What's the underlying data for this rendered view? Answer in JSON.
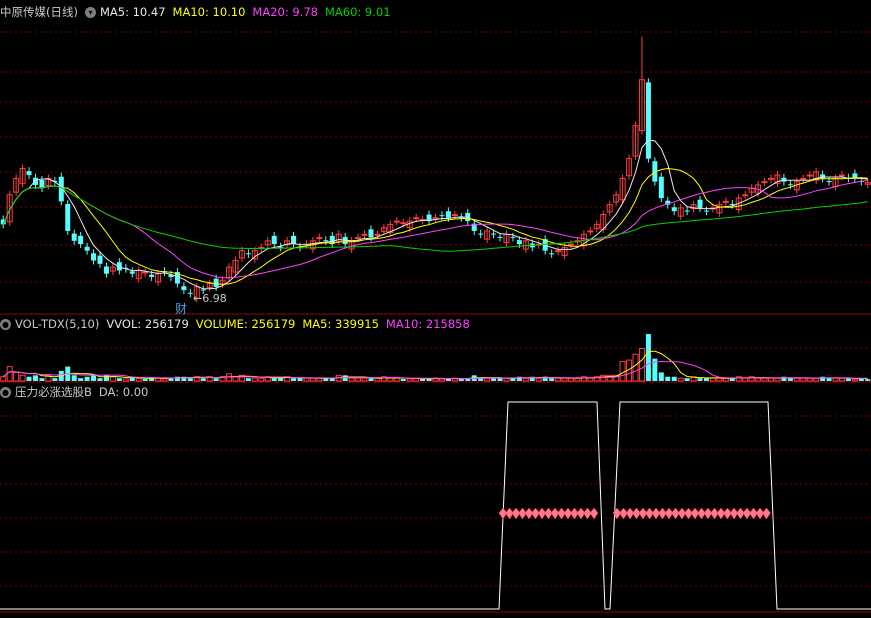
{
  "main_header": {
    "stock_title": "中原传媒(日线)",
    "ma5": "MA5: 10.47",
    "ma10": "MA10: 10.10",
    "ma20": "MA20: 9.78",
    "ma60": "MA60: 9.01"
  },
  "vol_header": {
    "indicator": "VOL-TDX(5,10)",
    "vvol": "VVOL: 256179",
    "volume": "VOLUME: 256179",
    "ma5": "MA5: 339915",
    "ma10": "MA10: 215858"
  },
  "custom_header": {
    "indicator": "压力必涨选股B",
    "da": "DA: 0.00"
  },
  "annotations": {
    "low_price": "6.98",
    "financial_marker": "财"
  },
  "colors": {
    "up": "#ff3c3c",
    "down": "#54ffff",
    "ma5": "#e8e8e8",
    "ma10": "#ffff00",
    "ma20": "#ff40ff",
    "ma60": "#00d200",
    "grid": "#7a0000",
    "signal_marker": "#ff7a8a"
  },
  "chart_data": {
    "type": "candlestick",
    "closes": [
      9.2,
      10.1,
      10.6,
      10.9,
      10.7,
      10.4,
      10.3,
      10.6,
      10.5,
      9.9,
      9.0,
      8.7,
      8.6,
      8.4,
      8.1,
      8.0,
      7.7,
      7.9,
      7.8,
      7.85,
      7.7,
      7.8,
      7.75,
      7.6,
      7.7,
      7.75,
      7.6,
      7.4,
      7.2,
      7.1,
      7.3,
      7.2,
      7.4,
      7.3,
      7.5,
      7.9,
      8.1,
      8.4,
      8.3,
      8.4,
      8.5,
      8.7,
      8.6,
      8.5,
      8.7,
      8.6,
      8.5,
      8.6,
      8.7,
      8.8,
      8.7,
      8.6,
      8.9,
      8.6,
      8.7,
      8.8,
      8.9,
      8.8,
      8.9,
      9.1,
      9.2,
      9.3,
      9.25,
      9.3,
      9.4,
      9.35,
      9.3,
      9.4,
      9.45,
      9.4,
      9.5,
      9.4,
      9.3,
      9.0,
      8.9,
      9.0,
      8.9,
      8.8,
      8.9,
      8.8,
      8.6,
      8.7,
      8.5,
      8.6,
      8.4,
      8.3,
      8.4,
      8.5,
      8.6,
      8.7,
      8.9,
      9.0,
      9.2,
      9.5,
      9.8,
      10.1,
      10.6,
      11.2,
      12.2,
      13.6,
      11.2,
      10.5,
      10.0,
      9.8,
      9.6,
      9.7,
      9.6,
      9.8,
      9.7,
      9.6,
      9.7,
      9.8,
      9.9,
      9.8,
      10.0,
      10.1,
      10.3,
      10.4,
      10.5,
      10.6,
      10.7,
      10.5,
      10.4,
      10.5,
      10.6,
      10.7,
      10.8,
      10.6,
      10.5,
      10.6,
      10.7,
      10.6,
      10.6,
      10.5,
      10.47
    ],
    "volume_ma5_last": 339915,
    "volume_ma10_last": 215858,
    "volume_last": 256179,
    "ma_last": {
      "ma5": 10.47,
      "ma10": 10.1,
      "ma20": 9.78,
      "ma60": 9.01
    },
    "signal": {
      "type": "step",
      "segments": [
        [
          0,
          0,
          0
        ],
        [
          501,
          595,
          1
        ],
        [
          607,
          607,
          0
        ],
        [
          615,
          772,
          1
        ],
        [
          778,
          871,
          0
        ]
      ]
    }
  }
}
